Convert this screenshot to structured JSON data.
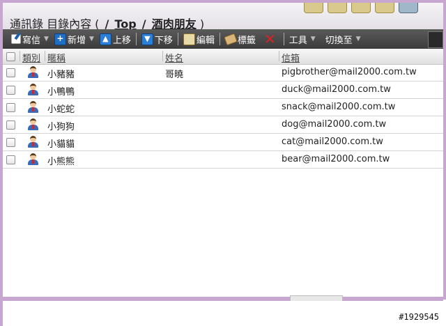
{
  "header": {
    "title_prefix": "通訊錄 目錄內容 (",
    "sep1": "/",
    "crumb_top": "Top",
    "sep2": "/",
    "crumb_group": "酒肉朋友",
    "title_suffix": ")"
  },
  "toolbar": {
    "write": "寫信",
    "add": "新增",
    "move_up": "上移",
    "move_down": "下移",
    "edit": "編輯",
    "tag": "標籤",
    "delete_icon": "✕",
    "tools": "工具",
    "switch_to": "切換至",
    "caret": "▼"
  },
  "columns": {
    "type": "類別",
    "nickname": "暱稱",
    "name": "姓名",
    "email": "信箱"
  },
  "contacts": [
    {
      "nickname": "小豬豬",
      "name": "哥曉",
      "email": "pigbrother@mail2000.com.tw"
    },
    {
      "nickname": "小鴨鴨",
      "name": "",
      "email": "duck@mail2000.com.tw"
    },
    {
      "nickname": "小蛇蛇",
      "name": "",
      "email": "snack@mail2000.com.tw"
    },
    {
      "nickname": "小狗狗",
      "name": "",
      "email": "dog@mail2000.com.tw"
    },
    {
      "nickname": "小貓貓",
      "name": "",
      "email": "cat@mail2000.com.tw"
    },
    {
      "nickname": "小熊熊",
      "name": "",
      "email": "bear@mail2000.com.tw"
    }
  ],
  "watermark": "#1929545",
  "colors": {
    "frame": "#c7a6cf",
    "toolbar_bg": "#3b3b3b",
    "delete_red": "#e02020"
  }
}
